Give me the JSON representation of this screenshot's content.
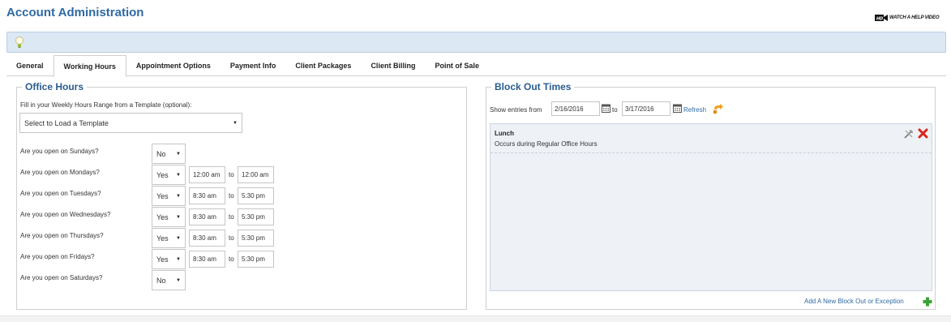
{
  "header": {
    "title": "Account Administration",
    "help_video_label": "WATCH A HELP VIDEO"
  },
  "tabs": [
    {
      "label": "General",
      "active": false
    },
    {
      "label": "Working Hours",
      "active": true
    },
    {
      "label": "Appointment Options",
      "active": false
    },
    {
      "label": "Payment Info",
      "active": false
    },
    {
      "label": "Client Packages",
      "active": false
    },
    {
      "label": "Client Billing",
      "active": false
    },
    {
      "label": "Point of Sale",
      "active": false
    }
  ],
  "office_hours": {
    "legend": "Office Hours",
    "template_label": "Fill in your Weekly Hours Range from a Template (optional):",
    "template_select": "Select to Load a Template",
    "to_label": "to",
    "days": [
      {
        "question": "Are you open on Sundays?",
        "open": "No",
        "start": "",
        "end": ""
      },
      {
        "question": "Are you open on Mondays?",
        "open": "Yes",
        "start": "12:00 am",
        "end": "12:00 am"
      },
      {
        "question": "Are you open on Tuesdays?",
        "open": "Yes",
        "start": "8:30 am",
        "end": "5:30 pm"
      },
      {
        "question": "Are you open on Wednesdays?",
        "open": "Yes",
        "start": "8:30 am",
        "end": "5:30 pm"
      },
      {
        "question": "Are you open on Thursdays?",
        "open": "Yes",
        "start": "8:30 am",
        "end": "5:30 pm"
      },
      {
        "question": "Are you open on Fridays?",
        "open": "Yes",
        "start": "8:30 am",
        "end": "5:30 pm"
      },
      {
        "question": "Are you open on Saturdays?",
        "open": "No",
        "start": "",
        "end": ""
      }
    ]
  },
  "block_out": {
    "legend": "Block Out Times",
    "show_entries_label": "Show entries from",
    "from_date": "2/16/2016",
    "to_label": "to",
    "to_date": "3/17/2016",
    "refresh_label": "Refresh",
    "entries": [
      {
        "title": "Lunch",
        "description": "Occurs during Regular Office Hours"
      }
    ],
    "add_new_label": "Add A New Block Out or Exception"
  },
  "colors": {
    "title": "#2f6aa3",
    "legend": "#2a5d8f",
    "link": "#2f6aa3",
    "infobar": "#dce8f4",
    "delete": "#d9261c",
    "add": "#3aa335"
  },
  "icons": [
    "video-camera-icon",
    "lightbulb-icon",
    "calendar-icon",
    "refresh-icon",
    "edit-icon",
    "delete-icon",
    "add-icon"
  ]
}
